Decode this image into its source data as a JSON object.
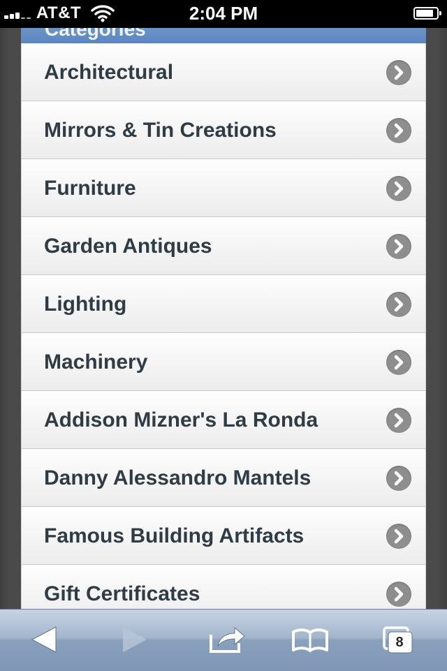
{
  "status_bar": {
    "carrier": "AT&T",
    "time": "2:04 PM",
    "battery_level": 0.85
  },
  "section_header": {
    "label": "Categories"
  },
  "categories": [
    {
      "label": "Architectural",
      "icon": "chevron-right-icon"
    },
    {
      "label": "Mirrors & Tin Creations",
      "icon": "chevron-right-icon"
    },
    {
      "label": "Furniture",
      "icon": "chevron-right-icon"
    },
    {
      "label": "Garden Antiques",
      "icon": "chevron-right-icon"
    },
    {
      "label": "Lighting",
      "icon": "chevron-right-icon"
    },
    {
      "label": "Machinery",
      "icon": "chevron-right-icon"
    },
    {
      "label": "Addison Mizner's La Ronda",
      "icon": "chevron-right-icon"
    },
    {
      "label": "Danny Alessandro Mantels",
      "icon": "chevron-right-icon"
    },
    {
      "label": "Famous Building Artifacts",
      "icon": "chevron-right-icon"
    },
    {
      "label": "Gift Certificates",
      "icon": "chevron-right-icon"
    }
  ],
  "toolbar": {
    "buttons": [
      "back-icon",
      "forward-icon",
      "share-icon",
      "bookmarks-icon",
      "tabs-icon"
    ],
    "tab_count": "8"
  },
  "colors": {
    "header_blue": "#5a86bf",
    "row_text": "#2f3b45",
    "chevron_circle": "#8e8e8e",
    "toolbar_blue": "#8aa1bd"
  }
}
